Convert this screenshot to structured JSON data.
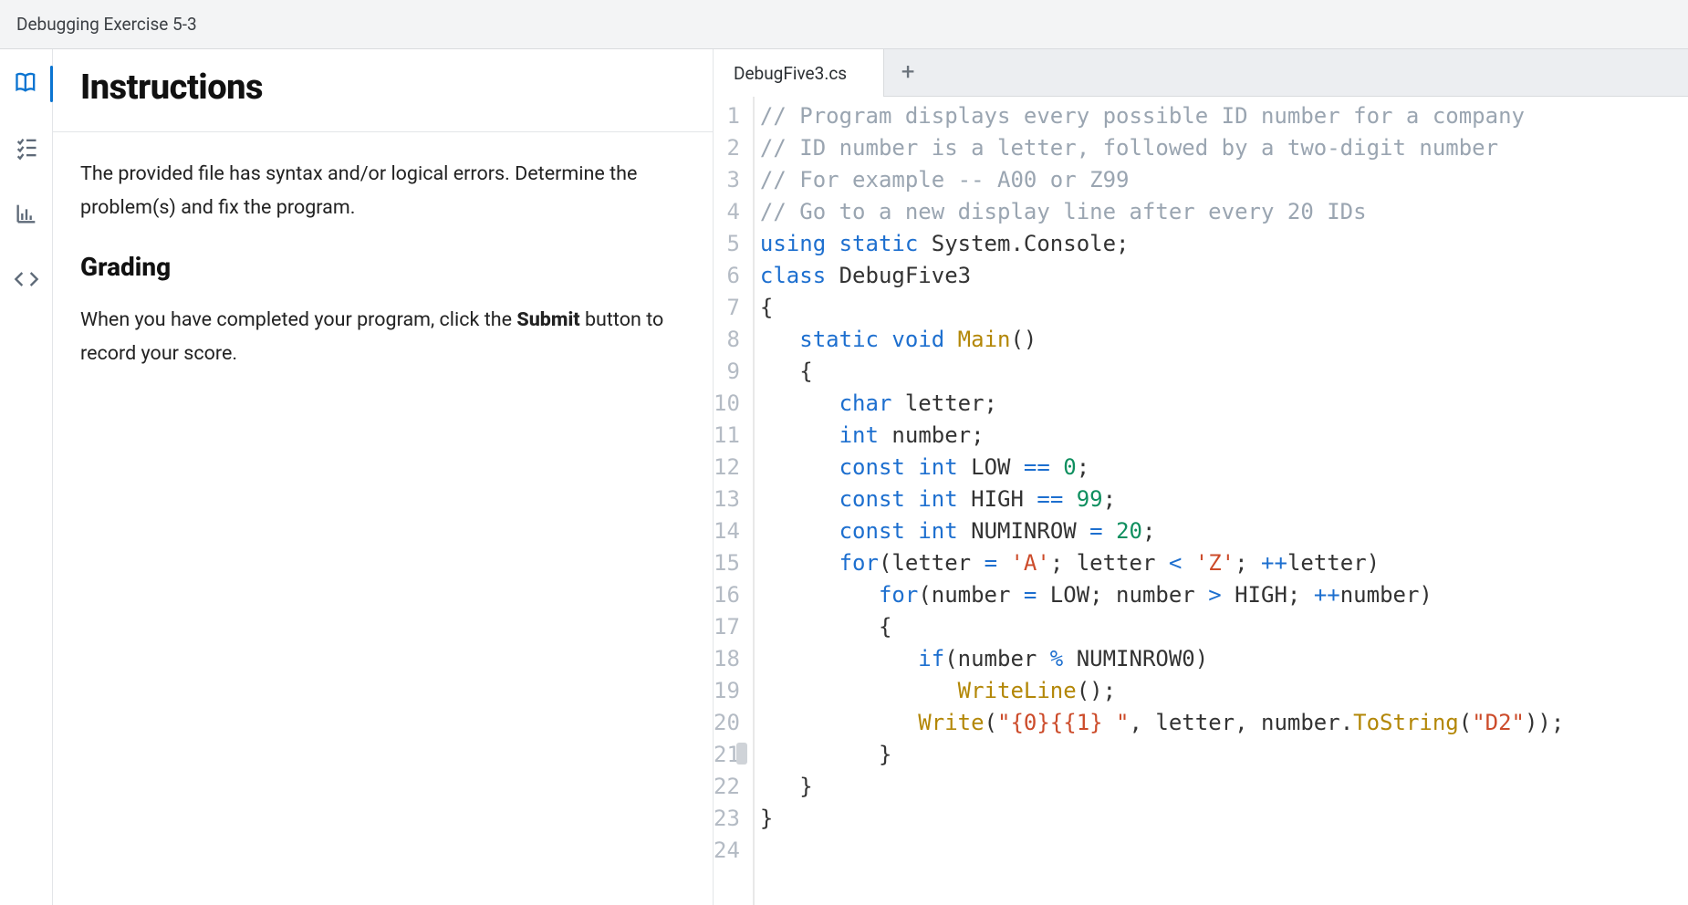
{
  "header": {
    "title": "Debugging Exercise 5-3"
  },
  "rail": {
    "items": [
      {
        "name": "book-icon",
        "active": true
      },
      {
        "name": "tasks-icon",
        "active": false
      },
      {
        "name": "chart-icon",
        "active": false
      },
      {
        "name": "code-icon",
        "active": false
      }
    ]
  },
  "instructions": {
    "title": "Instructions",
    "p1": "The provided file has syntax and/or logical errors. Determine the problem(s) and fix the program.",
    "grading_h": "Grading",
    "p2_pre": "When you have completed your program, click the ",
    "p2_bold": "Submit",
    "p2_post": " button to record your score."
  },
  "editor": {
    "tabs": [
      {
        "label": "DebugFive3.cs"
      }
    ],
    "add_tab_glyph": "+",
    "code": [
      [
        {
          "t": "// Program displays every possible ID number for a company",
          "c": "comment"
        }
      ],
      [
        {
          "t": "// ID number is a letter, followed by a two-digit number",
          "c": "comment"
        }
      ],
      [
        {
          "t": "// For example -- A00 or Z99",
          "c": "comment"
        }
      ],
      [
        {
          "t": "// Go to a new display line after every 20 IDs",
          "c": "comment"
        }
      ],
      [
        {
          "t": "using",
          "c": "kw"
        },
        {
          "t": " ",
          "c": "plain"
        },
        {
          "t": "static",
          "c": "kw"
        },
        {
          "t": " System.Console;",
          "c": "plain"
        }
      ],
      [
        {
          "t": "class",
          "c": "kw"
        },
        {
          "t": " DebugFive3",
          "c": "class"
        }
      ],
      [
        {
          "t": "{",
          "c": "plain"
        }
      ],
      [
        {
          "t": "   ",
          "c": "plain"
        },
        {
          "t": "static",
          "c": "kw"
        },
        {
          "t": " ",
          "c": "plain"
        },
        {
          "t": "void",
          "c": "kw"
        },
        {
          "t": " ",
          "c": "plain"
        },
        {
          "t": "Main",
          "c": "func"
        },
        {
          "t": "()",
          "c": "plain"
        }
      ],
      [
        {
          "t": "   {",
          "c": "plain"
        }
      ],
      [
        {
          "t": "      ",
          "c": "plain"
        },
        {
          "t": "char",
          "c": "kw"
        },
        {
          "t": " letter;",
          "c": "plain"
        }
      ],
      [
        {
          "t": "      ",
          "c": "plain"
        },
        {
          "t": "int",
          "c": "kw"
        },
        {
          "t": " number;",
          "c": "plain"
        }
      ],
      [
        {
          "t": "      ",
          "c": "plain"
        },
        {
          "t": "const",
          "c": "kw"
        },
        {
          "t": " ",
          "c": "plain"
        },
        {
          "t": "int",
          "c": "kw"
        },
        {
          "t": " LOW ",
          "c": "plain"
        },
        {
          "t": "==",
          "c": "op"
        },
        {
          "t": " ",
          "c": "plain"
        },
        {
          "t": "0",
          "c": "num"
        },
        {
          "t": ";",
          "c": "plain"
        }
      ],
      [
        {
          "t": "      ",
          "c": "plain"
        },
        {
          "t": "const",
          "c": "kw"
        },
        {
          "t": " ",
          "c": "plain"
        },
        {
          "t": "int",
          "c": "kw"
        },
        {
          "t": " HIGH ",
          "c": "plain"
        },
        {
          "t": "==",
          "c": "op"
        },
        {
          "t": " ",
          "c": "plain"
        },
        {
          "t": "99",
          "c": "num"
        },
        {
          "t": ";",
          "c": "plain"
        }
      ],
      [
        {
          "t": "      ",
          "c": "plain"
        },
        {
          "t": "const",
          "c": "kw"
        },
        {
          "t": " ",
          "c": "plain"
        },
        {
          "t": "int",
          "c": "kw"
        },
        {
          "t": " NUMINROW ",
          "c": "plain"
        },
        {
          "t": "=",
          "c": "op"
        },
        {
          "t": " ",
          "c": "plain"
        },
        {
          "t": "20",
          "c": "num"
        },
        {
          "t": ";",
          "c": "plain"
        }
      ],
      [
        {
          "t": "      ",
          "c": "plain"
        },
        {
          "t": "for",
          "c": "kw"
        },
        {
          "t": "(letter ",
          "c": "plain"
        },
        {
          "t": "=",
          "c": "op"
        },
        {
          "t": " ",
          "c": "plain"
        },
        {
          "t": "'A'",
          "c": "str"
        },
        {
          "t": "; letter ",
          "c": "plain"
        },
        {
          "t": "<",
          "c": "op"
        },
        {
          "t": " ",
          "c": "plain"
        },
        {
          "t": "'Z'",
          "c": "str"
        },
        {
          "t": "; ",
          "c": "plain"
        },
        {
          "t": "++",
          "c": "op"
        },
        {
          "t": "letter)",
          "c": "plain"
        }
      ],
      [
        {
          "t": "         ",
          "c": "plain"
        },
        {
          "t": "for",
          "c": "kw"
        },
        {
          "t": "(number ",
          "c": "plain"
        },
        {
          "t": "=",
          "c": "op"
        },
        {
          "t": " LOW; number ",
          "c": "plain"
        },
        {
          "t": ">",
          "c": "op"
        },
        {
          "t": " HIGH; ",
          "c": "plain"
        },
        {
          "t": "++",
          "c": "op"
        },
        {
          "t": "number)",
          "c": "plain"
        }
      ],
      [
        {
          "t": "         {",
          "c": "plain"
        }
      ],
      [
        {
          "t": "            ",
          "c": "plain"
        },
        {
          "t": "if",
          "c": "kw"
        },
        {
          "t": "(number ",
          "c": "plain"
        },
        {
          "t": "%",
          "c": "op"
        },
        {
          "t": " NUMINROW0)",
          "c": "plain"
        }
      ],
      [
        {
          "t": "               ",
          "c": "plain"
        },
        {
          "t": "WriteLine",
          "c": "func"
        },
        {
          "t": "();",
          "c": "plain"
        }
      ],
      [
        {
          "t": "            ",
          "c": "plain"
        },
        {
          "t": "Write",
          "c": "func"
        },
        {
          "t": "(",
          "c": "plain"
        },
        {
          "t": "\"{0}{{1} \"",
          "c": "str"
        },
        {
          "t": ", letter, number.",
          "c": "plain"
        },
        {
          "t": "ToString",
          "c": "func"
        },
        {
          "t": "(",
          "c": "plain"
        },
        {
          "t": "\"D2\"",
          "c": "str"
        },
        {
          "t": "));",
          "c": "plain"
        }
      ],
      [
        {
          "t": "         }",
          "c": "plain"
        }
      ],
      [
        {
          "t": "   }",
          "c": "plain"
        }
      ],
      [
        {
          "t": "}",
          "c": "plain"
        }
      ],
      [
        {
          "t": "",
          "c": "plain"
        }
      ]
    ]
  }
}
